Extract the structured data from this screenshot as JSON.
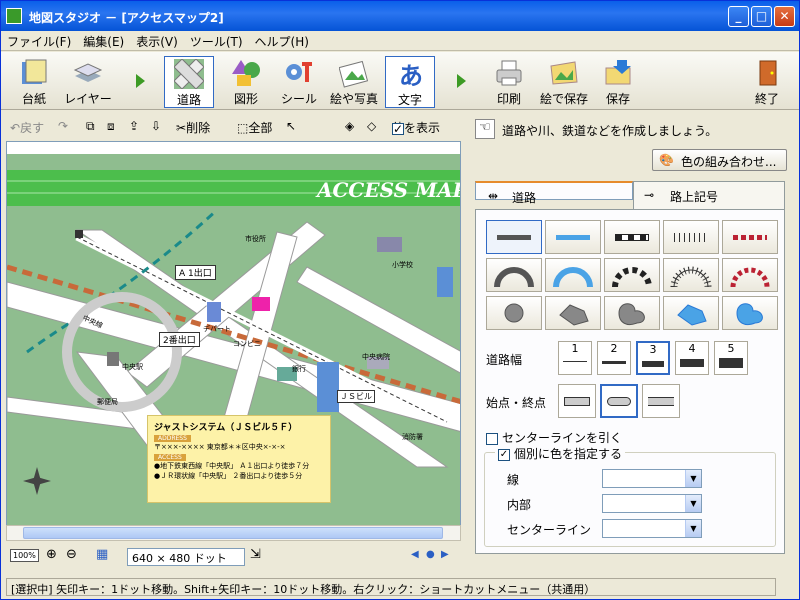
{
  "window": {
    "title": "地図スタジオ － [アクセスマップ2]"
  },
  "menu": [
    "ファイル(F)",
    "編集(E)",
    "表示(V)",
    "ツール(T)",
    "ヘルプ(H)"
  ],
  "main_toolbar": [
    {
      "label": "台紙",
      "icon": "mount-board-icon"
    },
    {
      "label": "レイヤー",
      "icon": "layer-icon"
    },
    {
      "label": "道路",
      "icon": "road-icon",
      "active": true
    },
    {
      "label": "図形",
      "icon": "shape-icon"
    },
    {
      "label": "シール",
      "icon": "sticker-icon"
    },
    {
      "label": "絵や写真",
      "icon": "picture-icon"
    },
    {
      "label": "文字",
      "icon": "text-icon"
    },
    {
      "label": "印刷",
      "icon": "printer-icon"
    },
    {
      "label": "絵で保存",
      "icon": "save-image-icon"
    },
    {
      "label": "保存",
      "icon": "save-icon"
    },
    {
      "label": "終了",
      "icon": "exit-door-icon"
    }
  ],
  "sub_toolbar": {
    "undo": "戻す",
    "delete": "削除",
    "select_all": "全部",
    "show_others": "他を表示"
  },
  "map": {
    "banner": "ACCESS MAP",
    "labels": [
      "A 1出口",
      "2番出口",
      "ＪＳビル",
      "デパート",
      "コンビニ",
      "銀行",
      "中央病院",
      "消防署",
      "小学校",
      "市役所",
      "郵便局",
      "中央駅",
      "中央線"
    ],
    "infobox": {
      "title": "ジャストシステム（ＪＳビル５Ｆ）",
      "address_tag": "ADDRESS",
      "address": "〒×××-×××× 東京都＊＊区中央×-×-×",
      "access_tag": "ACCESS",
      "access_lines": [
        "●地下鉄東西線「中央駅」 Ａ１出口より徒歩７分",
        "●ＪＲ環状線「中央駅」 ２番出口より徒歩５分"
      ]
    }
  },
  "bottom": {
    "zoom": "100%",
    "size": "640 × 480 ドット"
  },
  "status": "[選択中] 矢印キー：1ドット移動。Shift+矢印キー：10ドット移動。右クリック：ショートカットメニュー（共通用）",
  "panel": {
    "hint": "道路や川、鉄道などを作成しましょう。",
    "color_button": "色の組み合わせ...",
    "tabs": [
      "道路",
      "路上記号"
    ],
    "width_label": "道路幅",
    "widths": [
      "1",
      "2",
      "3",
      "4",
      "5"
    ],
    "selected_width": "3",
    "endpoint_label": "始点・終点",
    "centerline": "センターラインを引く",
    "individual": "個別に色を指定する",
    "line": "線",
    "inner": "内部",
    "center_line": "センターライン"
  }
}
